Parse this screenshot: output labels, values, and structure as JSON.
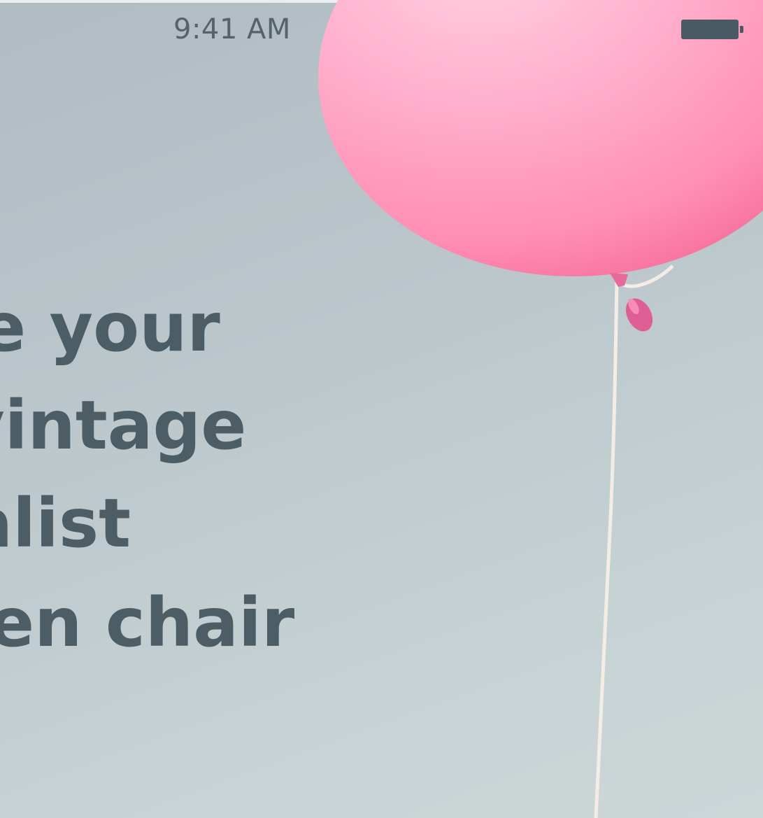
{
  "status_bar": {
    "time": "9:41 AM",
    "battery_icon": "battery-full-icon"
  },
  "headline": {
    "lines": [
      "e your",
      "vintage",
      "nalist",
      "en chair"
    ]
  },
  "illustration": {
    "subject": "pink-balloon",
    "balloon_color": "#ff8fb5",
    "string_color": "#f4ede6"
  },
  "colors": {
    "text": "#4d5d66",
    "status_text": "#56636a",
    "background": "#bcc8cc"
  }
}
